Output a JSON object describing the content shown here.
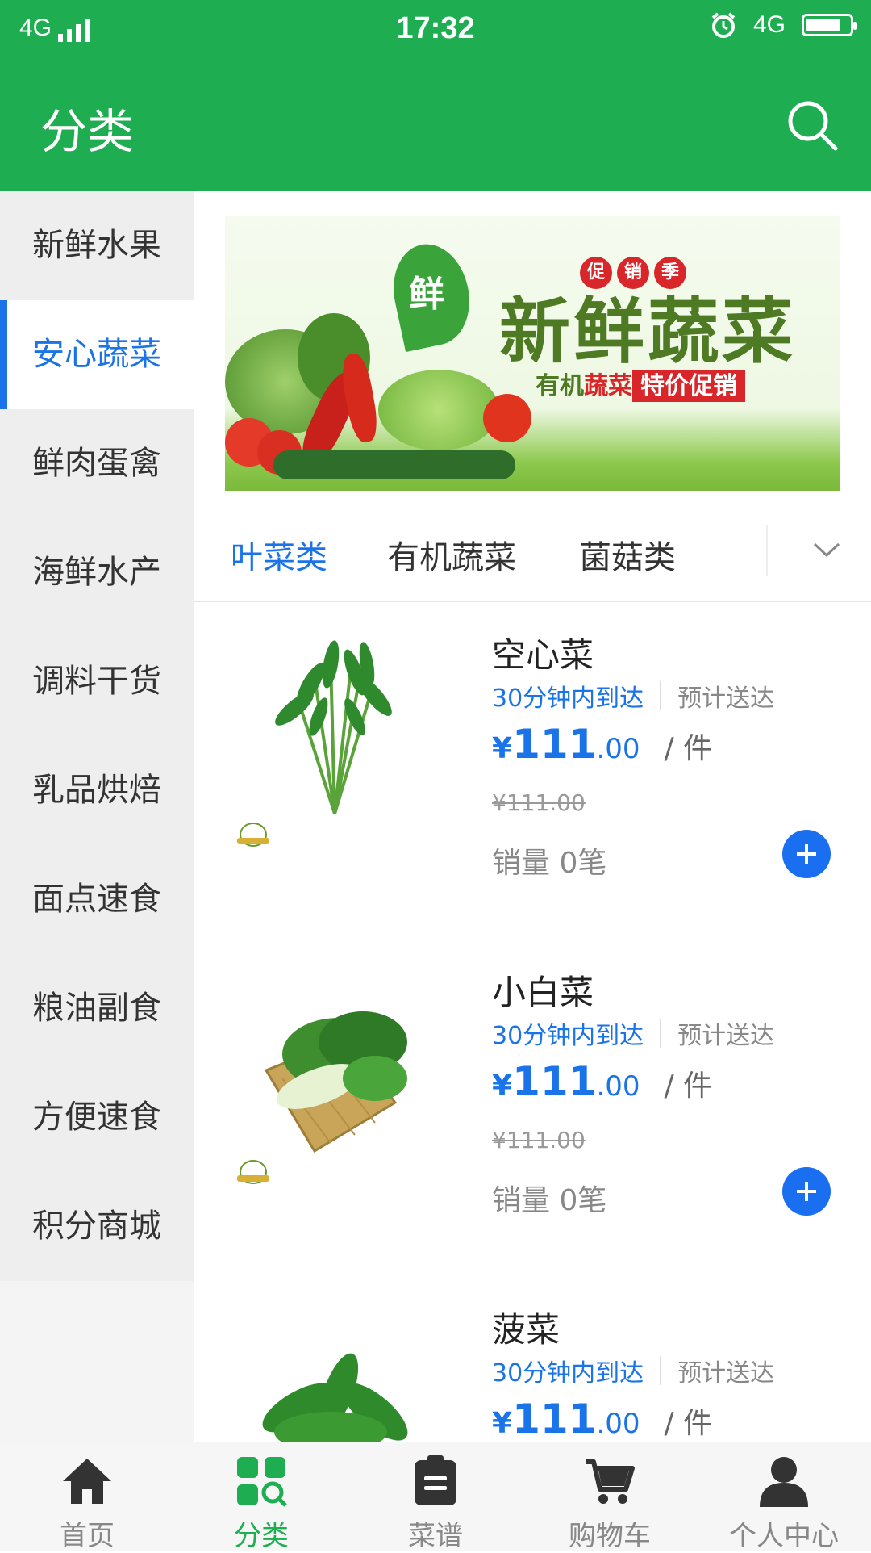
{
  "status_bar": {
    "network_left": "4G",
    "time": "17:32",
    "network_right": "4G"
  },
  "header": {
    "title": "分类"
  },
  "sidebar": {
    "items": [
      {
        "label": "新鲜水果",
        "active": false
      },
      {
        "label": "安心蔬菜",
        "active": true
      },
      {
        "label": "鲜肉蛋禽",
        "active": false
      },
      {
        "label": "海鲜水产",
        "active": false
      },
      {
        "label": "调料干货",
        "active": false
      },
      {
        "label": "乳品烘焙",
        "active": false
      },
      {
        "label": "面点速食",
        "active": false
      },
      {
        "label": "粮油副食",
        "active": false
      },
      {
        "label": "方便速食",
        "active": false
      },
      {
        "label": "积分商城",
        "active": false
      }
    ]
  },
  "banner": {
    "logo_text": "鲜",
    "badge_chars": [
      "促",
      "销",
      "季"
    ],
    "headline": "新鲜蔬菜",
    "subline_part1": "有机",
    "subline_part2": "蔬菜",
    "subline_part3": "特价促销"
  },
  "subtabs": {
    "items": [
      {
        "label": "叶菜类",
        "active": true
      },
      {
        "label": "有机蔬菜",
        "active": false
      },
      {
        "label": "菌菇类",
        "active": false
      }
    ]
  },
  "products": [
    {
      "name": "空心菜",
      "delivery_fast": "30分钟内到达",
      "delivery_eta": "预计送达",
      "currency": "¥",
      "price_int": "111",
      "price_dec": ".00",
      "unit": "/ 件",
      "original_price": "¥111.00",
      "sales": "销量 0笔"
    },
    {
      "name": "小白菜",
      "delivery_fast": "30分钟内到达",
      "delivery_eta": "预计送达",
      "currency": "¥",
      "price_int": "111",
      "price_dec": ".00",
      "unit": "/ 件",
      "original_price": "¥111.00",
      "sales": "销量 0笔"
    },
    {
      "name": "菠菜",
      "delivery_fast": "30分钟内到达",
      "delivery_eta": "预计送达",
      "currency": "¥",
      "price_int": "111",
      "price_dec": ".00",
      "unit": "/ 件"
    }
  ],
  "bottom_nav": {
    "items": [
      {
        "label": "首页",
        "icon": "home-icon",
        "active": false
      },
      {
        "label": "分类",
        "icon": "category-search-icon",
        "active": true
      },
      {
        "label": "菜谱",
        "icon": "recipe-icon",
        "active": false
      },
      {
        "label": "购物车",
        "icon": "cart-icon",
        "active": false
      },
      {
        "label": "个人中心",
        "icon": "person-icon",
        "active": false
      }
    ]
  },
  "colors": {
    "brand_green": "#1fad52",
    "accent_blue": "#1a73e8",
    "add_button_blue": "#1a6ef0"
  }
}
